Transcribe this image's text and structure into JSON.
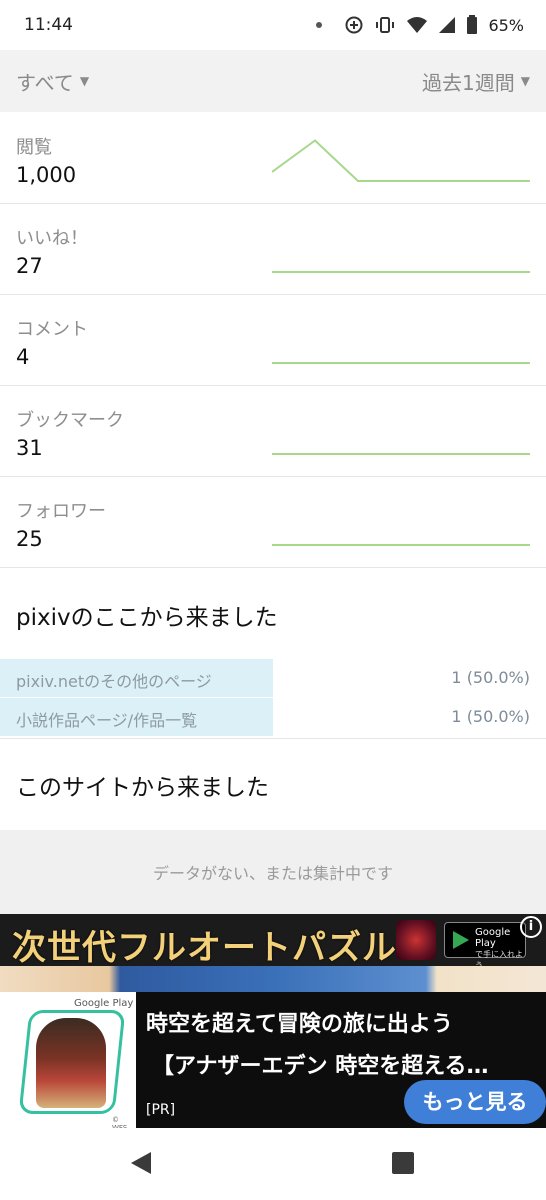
{
  "status": {
    "time": "11:44",
    "battery": "65%"
  },
  "filter": {
    "left_label": "すべて",
    "right_label": "過去1週間"
  },
  "metrics": [
    {
      "label": "閲覧",
      "value": "1,000",
      "trend": [
        0.2,
        0.9,
        0.0,
        0.0,
        0.0,
        0.0,
        0.0
      ]
    },
    {
      "label": "いいね！",
      "value": "27",
      "trend": [
        0,
        0,
        0,
        0,
        0,
        0,
        0
      ]
    },
    {
      "label": "コメント",
      "value": "4",
      "trend": [
        0,
        0,
        0,
        0,
        0,
        0,
        0
      ]
    },
    {
      "label": "ブックマーク",
      "value": "31",
      "trend": [
        0,
        0,
        0,
        0,
        0,
        0,
        0
      ]
    },
    {
      "label": "フォロワー",
      "value": "25",
      "trend": [
        0,
        0,
        0,
        0,
        0,
        0,
        0
      ]
    }
  ],
  "referrals_pixiv": {
    "title": "pixivのここから来ました",
    "rows": [
      {
        "name": "pixiv.netのその他のページ",
        "count": "1 (50.0%)",
        "share": 0.5
      },
      {
        "name": "小説作品ページ/作品一覧",
        "count": "1 (50.0%)",
        "share": 0.5
      }
    ]
  },
  "referrals_site": {
    "title": "このサイトから来ました",
    "empty_text": "データがない、または集計中です"
  },
  "ad": {
    "banner_headline": "次世代フルオートパズル",
    "google_play": "Google Play",
    "google_play_sub": "で手に入れよう",
    "info": "i",
    "thumb_label": "Google Play",
    "copyright": "© WFS",
    "title_line1": "時空を超えて冒険の旅に出よう",
    "title_line2": "【アナザーエデン 時空を超える…",
    "pr_label": "[PR]",
    "more_button": "もっと見る"
  },
  "colors": {
    "chart_line": "#a8d88a",
    "accent_bar": "#dcf0f8"
  }
}
